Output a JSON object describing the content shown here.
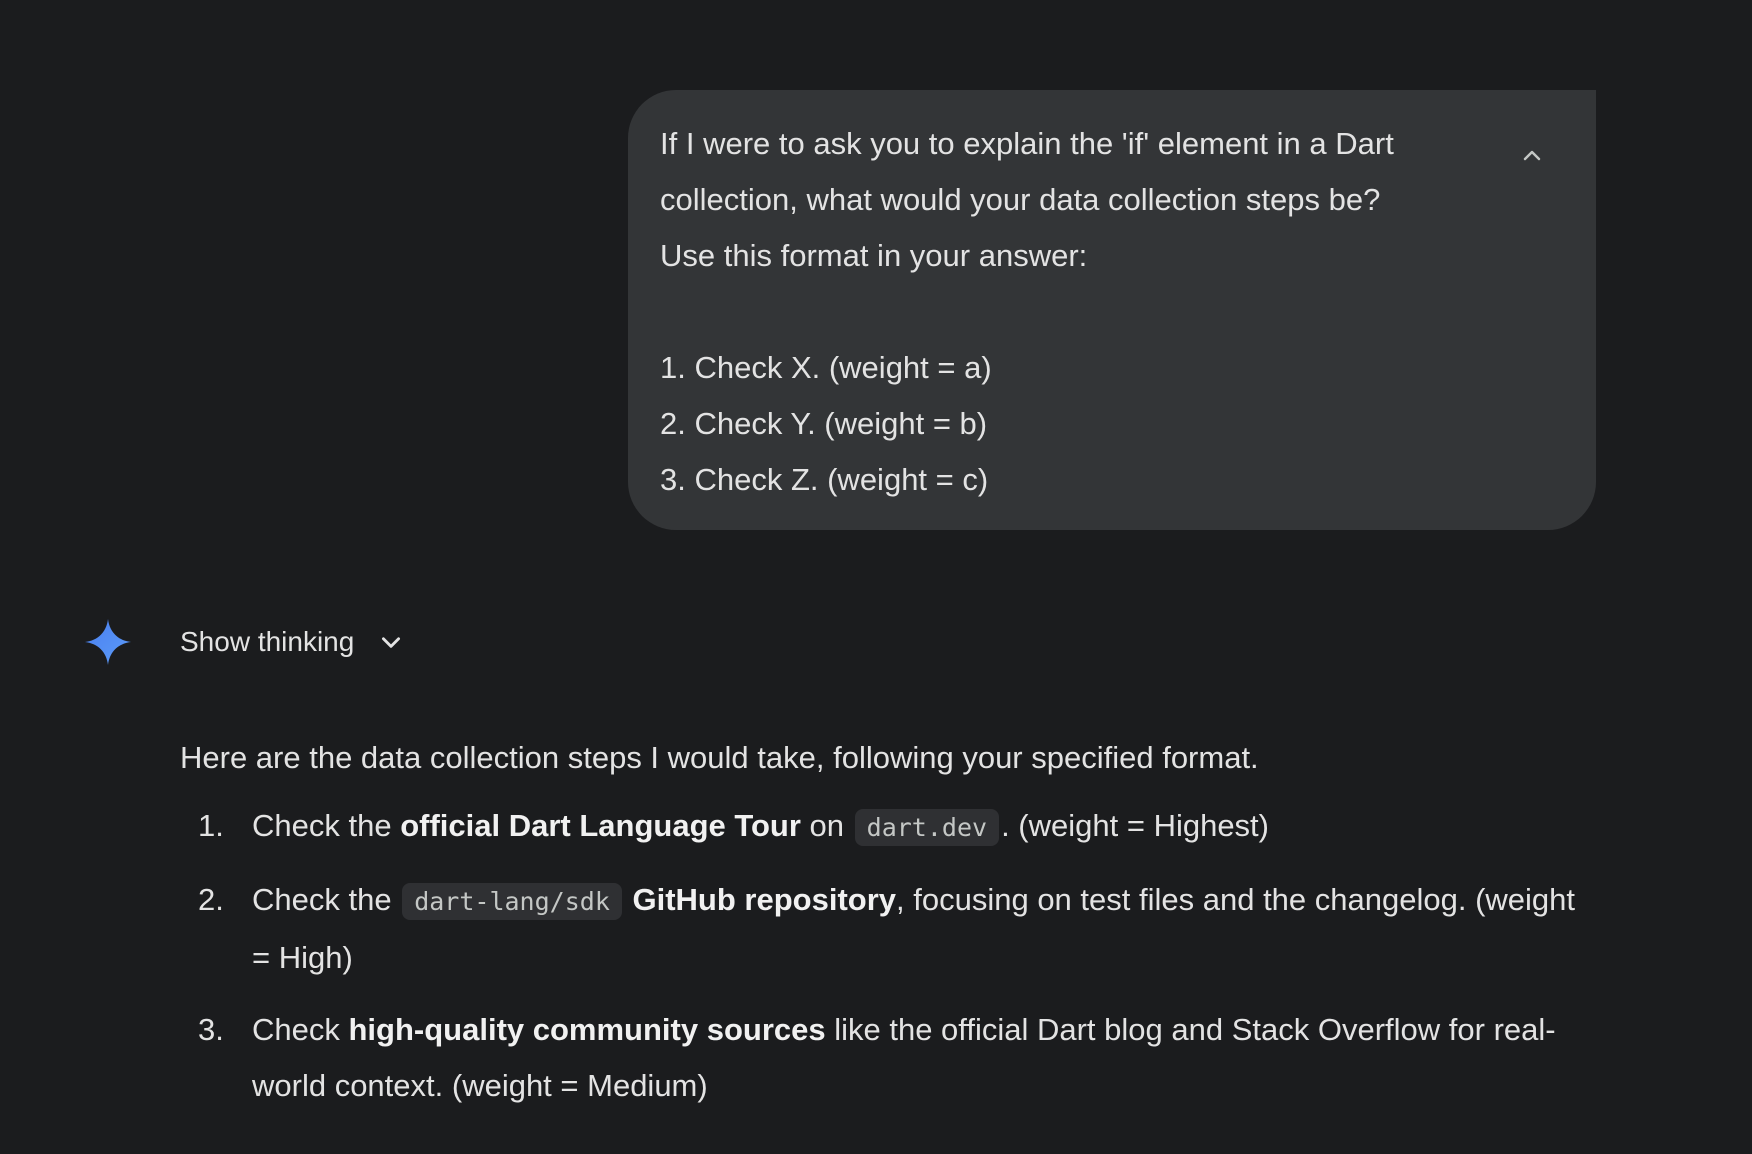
{
  "user_message": {
    "lines": [
      "If I were to ask you to explain the 'if' element in a Dart",
      "collection, what would your data collection steps be?",
      "Use this format in your answer:",
      "",
      "1. Check X. (weight = a)",
      "2. Check Y. (weight = b)",
      "3. Check Z. (weight = c)"
    ],
    "collapse_icon": "chevron-up-icon"
  },
  "response": {
    "avatar_icon": "gemini-spark-icon",
    "show_thinking_label": "Show thinking",
    "show_thinking_icon": "chevron-down-icon",
    "intro": "Here are the data collection steps I would take, following your specified format.",
    "steps": [
      {
        "number": "1.",
        "pre": "Check the ",
        "bold": "official Dart Language Tour",
        "mid": " on ",
        "code": "dart.dev",
        "post": ". (weight = Highest)"
      },
      {
        "number": "2.",
        "pre": "Check the ",
        "code": "dart-lang/sdk",
        "mid": " ",
        "bold": "GitHub repository",
        "post": ", focusing on test files and the changelog. (weight = High)"
      },
      {
        "number": "3.",
        "pre": "Check ",
        "bold": "high-quality community sources",
        "post": " like the official Dart blog and Stack Overflow for real-world context. (weight = Medium)"
      }
    ]
  },
  "colors": {
    "background": "#1b1c1e",
    "bubble": "#333537",
    "text": "#e3e3e3",
    "spark_blue": "#4c8df6"
  }
}
